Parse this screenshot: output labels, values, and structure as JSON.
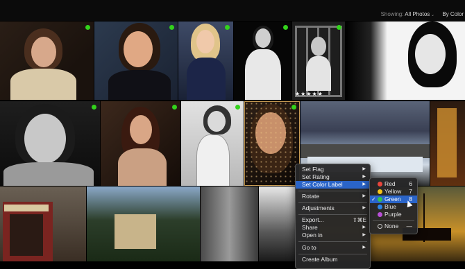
{
  "toolbar": {
    "showing_label": "Showing:",
    "showing_value": "All Photos",
    "sort_label": "By Color"
  },
  "photos": {
    "rating_stars": "★★★★★",
    "grid_control": "⊶\n⊷"
  },
  "context_menu": {
    "items": [
      {
        "label": "Set Flag",
        "submenu": true
      },
      {
        "label": "Set Rating",
        "submenu": true
      },
      {
        "label": "Set Color Label",
        "submenu": true,
        "highlighted": true
      },
      {
        "label": "Rotate",
        "submenu": true
      },
      {
        "label": "Adjustments",
        "submenu": true
      },
      {
        "label": "Export...",
        "shortcut": "⇧⌘E"
      },
      {
        "label": "Share",
        "submenu": true
      },
      {
        "label": "Open in",
        "submenu": true
      },
      {
        "label": "Go to",
        "submenu": true
      },
      {
        "label": "Create Album"
      }
    ],
    "arrow": "▶"
  },
  "color_label_submenu": {
    "items": [
      {
        "label": "Red",
        "key": "6",
        "color": "#e8453c"
      },
      {
        "label": "Yellow",
        "key": "7",
        "color": "#f5c51b"
      },
      {
        "label": "Green",
        "key": "8",
        "color": "#33c24d",
        "checked": true,
        "highlighted": true
      },
      {
        "label": "Blue",
        "key": "",
        "color": "#2e86e6"
      },
      {
        "label": "Purple",
        "key": "",
        "color": "#b84fd6"
      },
      {
        "label": "None",
        "key": "—"
      }
    ],
    "check_mark": "✓"
  },
  "colors": {
    "accent_highlight": "#2a64c8",
    "green_label": "#33d21c",
    "selection_border": "#c79b52"
  }
}
